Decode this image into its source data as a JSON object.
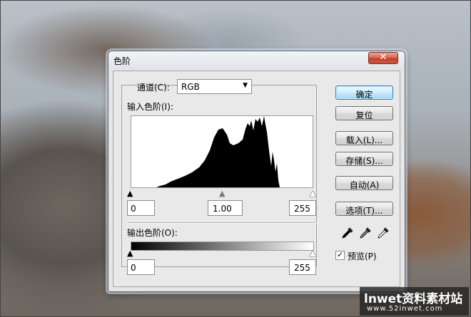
{
  "dialog": {
    "title": "色阶",
    "close_label": "✕"
  },
  "channel": {
    "label": "通道(C):",
    "selected": "RGB"
  },
  "input_levels": {
    "label": "输入色阶(I):",
    "black": "0",
    "gamma": "1.00",
    "white": "255"
  },
  "output_levels": {
    "label": "输出色阶(O):",
    "black": "0",
    "white": "255"
  },
  "buttons": {
    "ok": "确定",
    "reset": "复位",
    "load": "载入(L)...",
    "save": "存储(S)...",
    "auto": "自动(A)",
    "options": "选项(T)..."
  },
  "preview": {
    "label": "预览(P)",
    "checked": true
  },
  "icons": {
    "black_point": "eyedropper-black-icon",
    "gray_point": "eyedropper-gray-icon",
    "white_point": "eyedropper-white-icon"
  },
  "watermark": {
    "brand": "lnwet资料素材站",
    "url": "www.52inwet.com"
  }
}
